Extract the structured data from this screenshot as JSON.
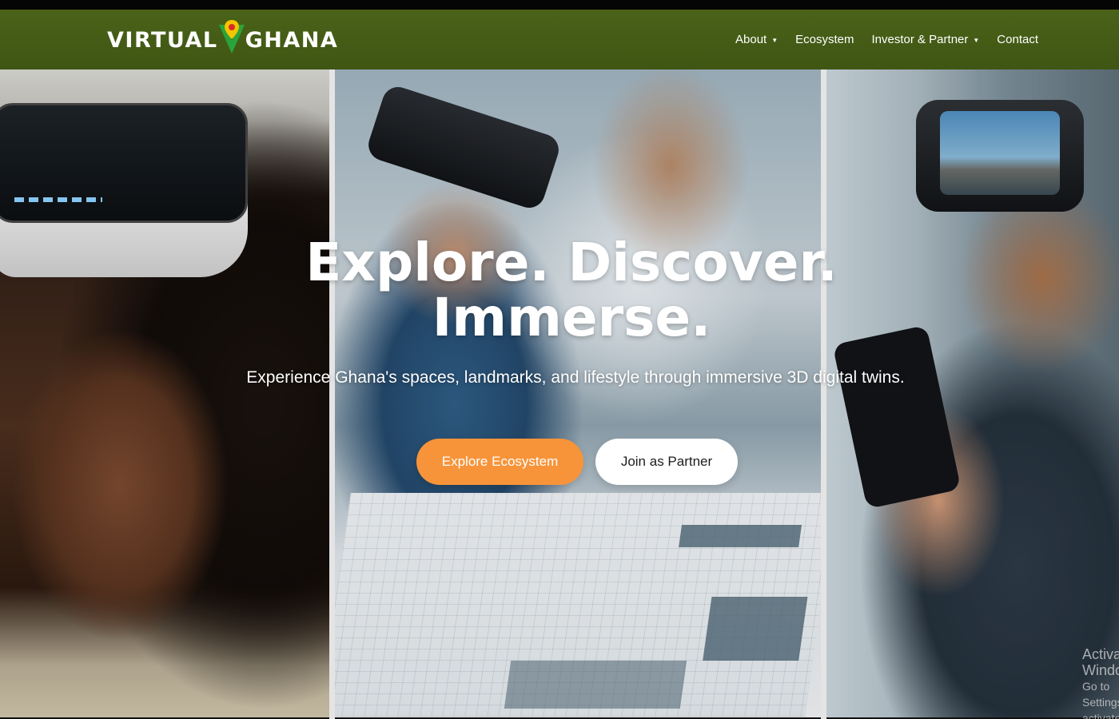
{
  "header": {
    "logo_left": "VIRTUAL",
    "logo_right": "GHANA",
    "nav": [
      {
        "label": "About",
        "dropdown": true
      },
      {
        "label": "Ecosystem",
        "dropdown": false
      },
      {
        "label": "Investor & Partner",
        "dropdown": true
      },
      {
        "label": "Contact",
        "dropdown": false
      }
    ],
    "caret": "▼"
  },
  "hero": {
    "title_line1": "Explore. Discover.",
    "title_line2": "Immerse.",
    "subtitle": "Experience Ghana's spaces, landmarks, and lifestyle through immersive 3D digital twins.",
    "primary_button": "Explore Ecosystem",
    "secondary_button": "Join as Partner"
  },
  "watermark": {
    "line1": "Activate Windows",
    "line2": "Go to Settings to activate Windows."
  },
  "colors": {
    "navbar": "#425a15",
    "primary_button": "#f7943a",
    "logo_green": "#2aa33a",
    "logo_yellow": "#f5c400",
    "logo_red": "#d62b2b"
  }
}
